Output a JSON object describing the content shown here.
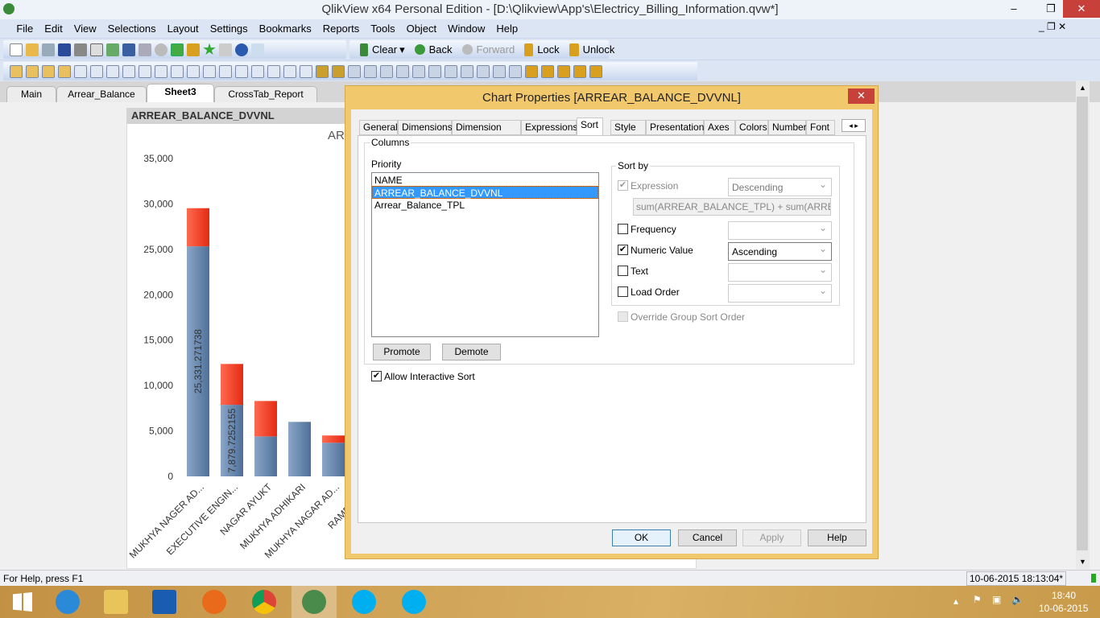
{
  "window": {
    "title": "QlikView x64 Personal Edition - [D:\\Qlikview\\App's\\Electricy_Billing_Information.qvw*]",
    "minimize": "–",
    "restore": "❐",
    "close": "✕"
  },
  "menu": [
    "File",
    "Edit",
    "View",
    "Selections",
    "Layout",
    "Settings",
    "Bookmarks",
    "Reports",
    "Tools",
    "Object",
    "Window",
    "Help"
  ],
  "toolbar": {
    "clear": "Clear",
    "back": "Back",
    "forward": "Forward",
    "lock": "Lock",
    "unlock": "Unlock"
  },
  "sheet_tabs": [
    {
      "label": "Main"
    },
    {
      "label": "Arrear_Balance"
    },
    {
      "label": "Sheet3",
      "active": true
    },
    {
      "label": "CrossTab_Report"
    }
  ],
  "chart_object": {
    "caption": "ARREAR_BALANCE_DVVNL",
    "title_visible": "AR"
  },
  "chart_data": {
    "type": "bar",
    "stacked": true,
    "title": "AR",
    "categories": [
      "MUKHYA NAGER AD...",
      "EXECUTIVE ENGIN...",
      "NAGAR AYUKT",
      "MUKHYA ADHIKARI",
      "MUKHYA NAGAR AD...",
      "RAMESH C..."
    ],
    "series": [
      {
        "values": [
          25331.271738,
          7879.7252155,
          4400,
          6000,
          3700,
          null
        ],
        "color": "#5b7fa8"
      },
      {
        "values": [
          4200,
          4500,
          3900,
          0,
          800,
          null
        ],
        "color": "#ee3322"
      }
    ],
    "data_labels": [
      "25,331.271738",
      "7,879.7252155"
    ],
    "yticks": [
      "0",
      "5,000",
      "10,000",
      "15,000",
      "20,000",
      "25,000",
      "30,000",
      "35,000"
    ],
    "ylim": [
      0,
      35000
    ]
  },
  "dialog": {
    "title": "Chart Properties [ARREAR_BALANCE_DVVNL]",
    "close": "✕",
    "tabs": [
      "General",
      "Dimensions",
      "Dimension Limits",
      "Expressions",
      "Sort",
      "Style",
      "Presentation",
      "Axes",
      "Colors",
      "Number",
      "Font"
    ],
    "active_tab": "Sort",
    "columns_label": "Columns",
    "priority_label": "Priority",
    "priority_items": [
      "NAME",
      "ARREAR_BALANCE_DVVNL",
      "Arrear_Balance_TPL"
    ],
    "selected_item": "ARREAR_BALANCE_DVVNL",
    "sort_by_label": "Sort by",
    "expression": {
      "label": "Expression",
      "checked": true,
      "disabled": true,
      "order": "Descending",
      "formula": "sum(ARREAR_BALANCE_TPL) + sum(ARREAR_BALANCE_DVVNL)"
    },
    "frequency": {
      "label": "Frequency",
      "checked": false
    },
    "numeric_value": {
      "label": "Numeric Value",
      "checked": true,
      "order": "Ascending"
    },
    "text": {
      "label": "Text",
      "checked": false
    },
    "load_order": {
      "label": "Load Order",
      "checked": false
    },
    "override": {
      "label": "Override Group Sort Order",
      "checked": false,
      "disabled": true
    },
    "promote": "Promote",
    "demote": "Demote",
    "allow_interactive_sort": {
      "label": "Allow Interactive Sort",
      "checked": true
    },
    "ok": "OK",
    "cancel": "Cancel",
    "apply": "Apply",
    "help": "Help"
  },
  "status": {
    "help": "For Help, press F1",
    "timestamp": "10-06-2015 18:13:04*"
  },
  "taskbar": {
    "apps": [
      "start",
      "internet-explorer",
      "file-explorer",
      "outlook",
      "firefox",
      "chrome",
      "qlikview",
      "skype",
      "skype"
    ],
    "time": "18:40",
    "date": "10-06-2015"
  }
}
